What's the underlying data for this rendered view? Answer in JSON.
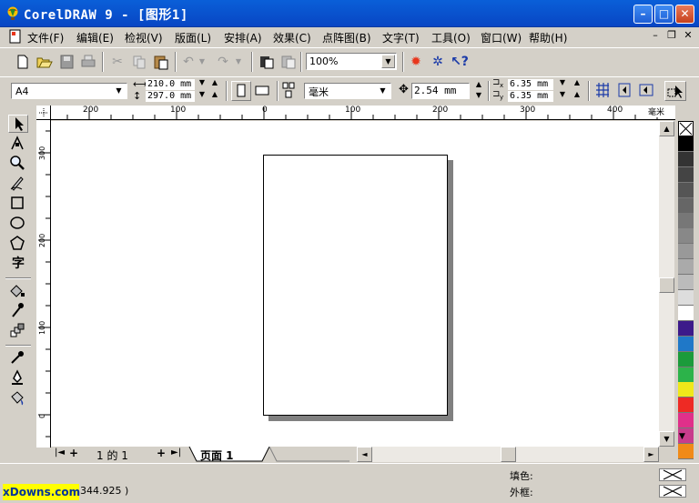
{
  "window": {
    "title": "CorelDRAW 9 - [图形1]",
    "minimize_glyph": "–",
    "maximize_glyph": "□",
    "close_glyph": "✕"
  },
  "menu": {
    "items": [
      "文件(F)",
      "编辑(E)",
      "检视(V)",
      "版面(L)",
      "安排(A)",
      "效果(C)",
      "点阵图(B)",
      "文字(T)",
      "工具(O)",
      "窗口(W)",
      "帮助(H)"
    ],
    "mdi_minimize": "–",
    "mdi_restore": "❐",
    "mdi_close": "✕"
  },
  "toolbar": {
    "zoom": "100%"
  },
  "property_bar": {
    "paper_size": "A4",
    "width": "210.0 mm",
    "height": "297.0 mm",
    "units": "毫米",
    "nudge": "2.54 mm",
    "dup_x": "6.35 mm",
    "dup_y": "6.35 mm",
    "dup_x_label": "x",
    "dup_y_label": "y"
  },
  "ruler": {
    "top_ticks": [
      "200",
      "100",
      "0",
      "100",
      "200",
      "300",
      "400"
    ],
    "top_unit": "毫米",
    "left_ticks": [
      "300",
      "200",
      "100",
      "0"
    ],
    "corner_unit": "毫米"
  },
  "page_nav": {
    "first": "|◄",
    "add_before": "+",
    "position": "1 的 1",
    "add_after": "+",
    "last": "►|",
    "tab_label": "页面 1"
  },
  "status": {
    "coords": "344.925 )",
    "fill_label": "填色:",
    "outline_label": "外框:",
    "watermark": "xDowns.com"
  },
  "palette": {
    "colors": [
      "#000000",
      "#333333",
      "#444444",
      "#555555",
      "#666666",
      "#777777",
      "#888888",
      "#999999",
      "#aaaaaa",
      "#bbbbbb",
      "#dddddd",
      "#ffffff",
      "#3c1a8a",
      "#1f78c8",
      "#1b9b3b",
      "#2cb34a",
      "#f0e81a",
      "#ee2a24",
      "#e0308a",
      "#c83c8c",
      "#f08a18"
    ]
  }
}
